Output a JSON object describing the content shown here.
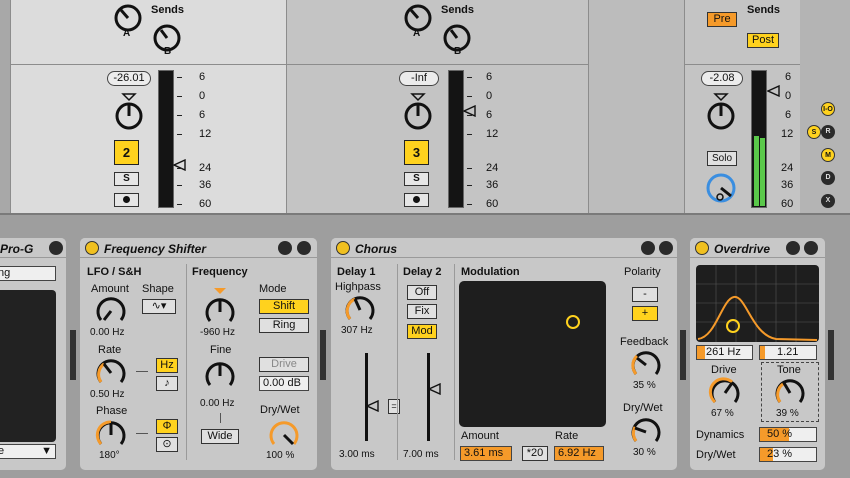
{
  "sends_label": "Sends",
  "send_a": "A",
  "send_b": "B",
  "meter_scale": [
    "6",
    "0",
    "6",
    "12",
    "24",
    "36",
    "60"
  ],
  "track2": {
    "volume": "-26.01",
    "number": "2",
    "solo": "S"
  },
  "track3": {
    "volume": "-Inf",
    "number": "3",
    "solo": "S"
  },
  "master": {
    "volume": "-2.08",
    "solo": "Solo",
    "pre": "Pre",
    "post": "Post"
  },
  "side_buttons": [
    "I-O",
    "S",
    "R",
    "M",
    "D",
    "X"
  ],
  "progdev": {
    "title": "Pro-G",
    "field": "ng",
    "dropdown": "e"
  },
  "freqshift": {
    "title": "Frequency Shifter",
    "lfo_title": "LFO / S&H",
    "amount_label": "Amount",
    "amount_value": "0.00 Hz",
    "shape_label": "Shape",
    "rate_label": "Rate",
    "rate_value": "0.50 Hz",
    "hz_btn": "Hz",
    "note_btn": "♪",
    "phase_label": "Phase",
    "phase_value": "180°",
    "phi_btn": "Φ",
    "spin_btn": "⊙",
    "frequency_label": "Frequency",
    "frequency_value": "-960 Hz",
    "mode_label": "Mode",
    "mode_shift": "Shift",
    "mode_ring": "Ring",
    "fine_label": "Fine",
    "fine_value": "0.00 Hz",
    "wide_btn": "Wide",
    "drive_btn": "Drive",
    "drive_value": "0.00 dB",
    "drywet_label": "Dry/Wet",
    "drywet_value": "100 %"
  },
  "chorus": {
    "title": "Chorus",
    "delay1_label": "Delay 1",
    "highpass_label": "Highpass",
    "highpass_value": "307 Hz",
    "delay1_value": "3.00 ms",
    "link_btn": "=",
    "delay2_label": "Delay 2",
    "off_btn": "Off",
    "fix_btn": "Fix",
    "mod_btn": "Mod",
    "delay2_value": "7.00 ms",
    "modulation_label": "Modulation",
    "amount_label": "Amount",
    "amount_value": "3.61 ms",
    "x20_btn": "*20",
    "rate_label": "Rate",
    "rate_value": "6.92 Hz",
    "polarity_label": "Polarity",
    "pol_minus": "-",
    "pol_plus": "+",
    "feedback_label": "Feedback",
    "feedback_value": "35 %",
    "drywet_label": "Dry/Wet",
    "drywet_value": "30 %"
  },
  "overdrive": {
    "title": "Overdrive",
    "freq_value": "261 Hz",
    "bw_value": "1.21",
    "drive_label": "Drive",
    "drive_value": "67 %",
    "tone_label": "Tone",
    "tone_value": "39 %",
    "dynamics_label": "Dynamics",
    "dynamics_value": "50 %",
    "drywet_label": "Dry/Wet",
    "drywet_value": "23 %"
  },
  "colors": {
    "yellow": "#ffd21e",
    "orange": "#f59a2a",
    "blue": "#3a8ee0",
    "green": "#5ac84a"
  }
}
